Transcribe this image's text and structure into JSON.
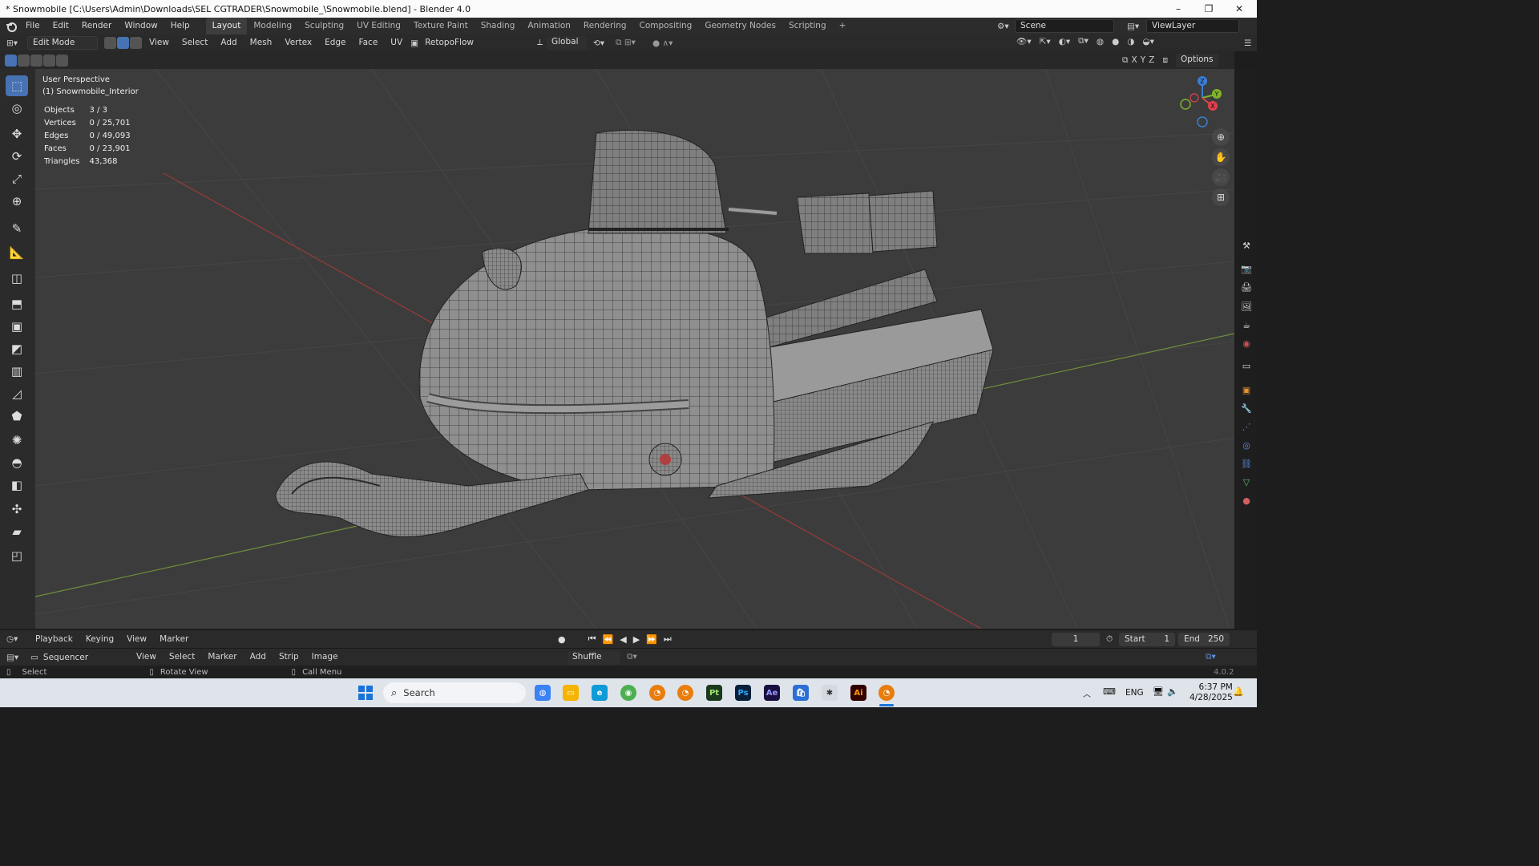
{
  "window": {
    "title": "* Snowmobile [C:\\Users\\Admin\\Downloads\\SEL CGTRADER\\Snowmobile_\\Snowmobile.blend] - Blender 4.0",
    "minimize": "–",
    "maximize": "❐",
    "close": "✕"
  },
  "menu": {
    "items": [
      "File",
      "Edit",
      "Render",
      "Window",
      "Help"
    ],
    "workspaces": [
      "Layout",
      "Modeling",
      "Sculpting",
      "UV Editing",
      "Texture Paint",
      "Shading",
      "Animation",
      "Rendering",
      "Compositing",
      "Geometry Nodes",
      "Scripting"
    ],
    "active_workspace": "Layout",
    "add_workspace": "+",
    "scene": "Scene",
    "view_layer": "ViewLayer"
  },
  "header": {
    "mode": "Edit Mode",
    "menus": [
      "View",
      "Select",
      "Add",
      "Mesh",
      "Vertex",
      "Edge",
      "Face",
      "UV"
    ],
    "addon": "RetopoFlow",
    "orientation": "Global",
    "options": "Options",
    "axes": [
      "X",
      "Y",
      "Z"
    ]
  },
  "viewport": {
    "perspective": "User Perspective",
    "object": "(1) Snowmobile_Interior",
    "stats": [
      {
        "label": "Objects",
        "value": "3 / 3"
      },
      {
        "label": "Vertices",
        "value": "0 / 25,701"
      },
      {
        "label": "Edges",
        "value": "0 / 49,093"
      },
      {
        "label": "Faces",
        "value": "0 / 23,901"
      },
      {
        "label": "Triangles",
        "value": "43,368"
      }
    ],
    "gizmo": {
      "z": "Z",
      "y": "Y",
      "x": "X"
    }
  },
  "timeline": {
    "menus": [
      "Playback",
      "Keying",
      "View",
      "Marker"
    ],
    "current_frame": "1",
    "start_label": "Start",
    "start": "1",
    "end_label": "End",
    "end": "250"
  },
  "sequencer": {
    "editor": "Sequencer",
    "menus": [
      "View",
      "Select",
      "Marker",
      "Add",
      "Strip",
      "Image"
    ],
    "mode": "Shuffle"
  },
  "status": {
    "select": "Select",
    "rotate": "Rotate View",
    "menu": "Call Menu",
    "version": "4.0.2"
  },
  "taskbar": {
    "search": "Search",
    "lang": "ENG",
    "time": "6:37 PM",
    "date": "4/28/2025",
    "apps": [
      "Pt",
      "Ps",
      "Ae",
      "Ai"
    ]
  },
  "colors": {
    "accent": "#4772b3",
    "x_axis": "#e0404f",
    "y_axis": "#7fb32a",
    "z_axis": "#3a7fd6"
  }
}
